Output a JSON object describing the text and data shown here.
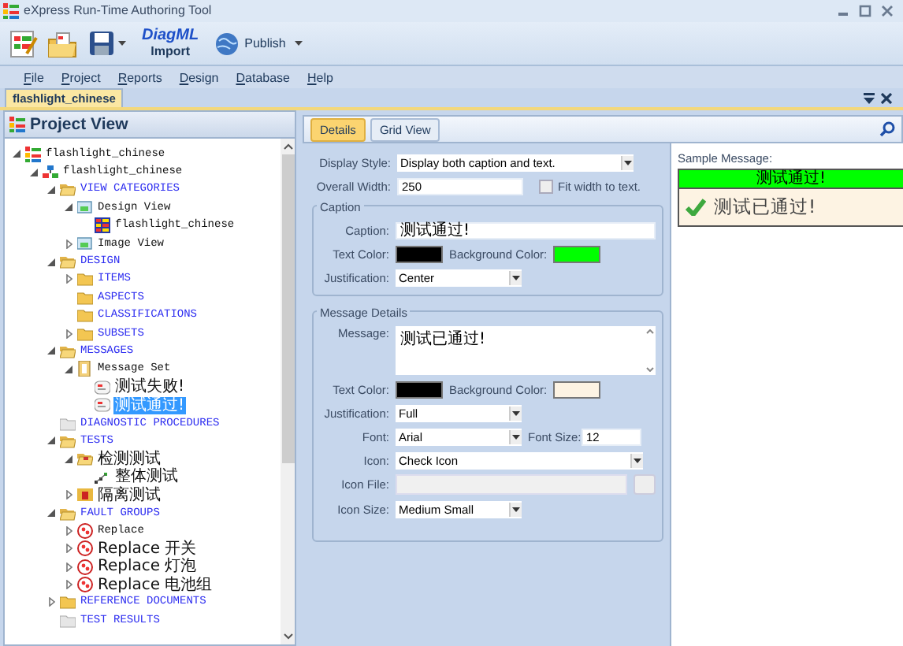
{
  "window": {
    "title": "eXpress Run-Time Authoring Tool"
  },
  "toolbar": {
    "import": {
      "title": "DiagML",
      "subtitle": "Import"
    },
    "publish": "Publish"
  },
  "menu": [
    "File",
    "Project",
    "Reports",
    "Design",
    "Database",
    "Help"
  ],
  "document_tabs": [
    {
      "label": "flashlight_chinese",
      "selected": true
    }
  ],
  "project_view": {
    "title": "Project View",
    "tree": [
      {
        "label": "flashlight_chinese",
        "kind": "root",
        "expanded": true,
        "selected": false,
        "children": [
          {
            "label": "flashlight_chinese",
            "kind": "project",
            "expanded": true,
            "selected": false,
            "children": [
              {
                "label": "VIEW CATEGORIES",
                "kind": "folder",
                "expanded": true,
                "selected": false,
                "children": [
                  {
                    "label": "Design View",
                    "kind": "view",
                    "expanded": true,
                    "selected": false,
                    "children": [
                      {
                        "label": "flashlight_chinese",
                        "kind": "grid",
                        "selected": false
                      }
                    ]
                  },
                  {
                    "label": "Image View",
                    "kind": "view",
                    "expanded": false,
                    "selected": false
                  }
                ]
              },
              {
                "label": "DESIGN",
                "kind": "folder",
                "expanded": true,
                "selected": false,
                "children": [
                  {
                    "label": "ITEMS",
                    "kind": "folder",
                    "expanded": false,
                    "selected": false
                  },
                  {
                    "label": "ASPECTS",
                    "kind": "folder",
                    "selected": false
                  },
                  {
                    "label": "CLASSIFICATIONS",
                    "kind": "folder",
                    "selected": false
                  },
                  {
                    "label": "SUBSETS",
                    "kind": "folder",
                    "expanded": false,
                    "selected": false
                  }
                ]
              },
              {
                "label": "MESSAGES",
                "kind": "folder",
                "expanded": true,
                "selected": false,
                "children": [
                  {
                    "label": "Message Set",
                    "kind": "message-set",
                    "expanded": true,
                    "selected": false,
                    "children": [
                      {
                        "label": "测试失败!",
                        "kind": "message",
                        "selected": false
                      },
                      {
                        "label": "测试通过!",
                        "kind": "message",
                        "selected": true
                      }
                    ]
                  }
                ]
              },
              {
                "label": "DIAGNOSTIC PROCEDURES",
                "kind": "empty-folder",
                "selected": false
              },
              {
                "label": "TESTS",
                "kind": "folder",
                "expanded": true,
                "selected": false,
                "children": [
                  {
                    "label": "检测测试",
                    "kind": "test-folder",
                    "expanded": true,
                    "selected": false,
                    "children": [
                      {
                        "label": "整体测试",
                        "kind": "test",
                        "selected": false
                      }
                    ]
                  },
                  {
                    "label": "隔离测试",
                    "kind": "test-set",
                    "expanded": false,
                    "selected": false
                  }
                ]
              },
              {
                "label": "FAULT GROUPS",
                "kind": "folder",
                "expanded": true,
                "selected": false,
                "children": [
                  {
                    "label": "Replace",
                    "kind": "fault",
                    "expanded": false,
                    "selected": false
                  },
                  {
                    "label": "Replace 开关",
                    "kind": "fault",
                    "expanded": false,
                    "selected": false
                  },
                  {
                    "label": "Replace 灯泡",
                    "kind": "fault",
                    "expanded": false,
                    "selected": false
                  },
                  {
                    "label": "Replace 电池组",
                    "kind": "fault",
                    "expanded": false,
                    "selected": false
                  }
                ]
              },
              {
                "label": "REFERENCE DOCUMENTS",
                "kind": "folder",
                "expanded": false,
                "selected": false
              },
              {
                "label": "TEST RESULTS",
                "kind": "empty-folder",
                "selected": false
              }
            ]
          }
        ]
      }
    ]
  },
  "detail_tabs": [
    {
      "label": "Details",
      "selected": true
    },
    {
      "label": "Grid View",
      "selected": false
    }
  ],
  "form": {
    "display_style": {
      "label": "Display Style:",
      "value": "Display both caption and text."
    },
    "overall_width": {
      "label": "Overall Width:",
      "value": "250"
    },
    "fit_width": {
      "label": "Fit width to text.",
      "checked": false
    },
    "caption_group": {
      "title": "Caption",
      "caption": {
        "label": "Caption:",
        "value": "测试通过!"
      },
      "text_color": {
        "label": "Text Color:",
        "color": "#000000"
      },
      "background_color": {
        "label": "Background Color:",
        "color": "#00ff00"
      },
      "justification": {
        "label": "Justification:",
        "value": "Center"
      }
    },
    "message_group": {
      "title": "Message Details",
      "message": {
        "label": "Message:",
        "value": "测试已通过!"
      },
      "text_color": {
        "label": "Text Color:",
        "color": "#000000"
      },
      "background_color": {
        "label": "Background Color:",
        "color": "#fdf3e3"
      },
      "justification": {
        "label": "Justification:",
        "value": "Full"
      },
      "font": {
        "label": "Font:",
        "value": "Arial"
      },
      "font_size": {
        "label": "Font Size:",
        "value": "12"
      },
      "icon": {
        "label": "Icon:",
        "value": "Check Icon"
      },
      "icon_file": {
        "label": "Icon File:",
        "disabled": true
      },
      "icon_size": {
        "label": "Icon Size:",
        "value": "Medium Small"
      }
    }
  },
  "sample": {
    "label": "Sample Message:",
    "caption": "测试通过!",
    "message": "测试已通过!"
  }
}
